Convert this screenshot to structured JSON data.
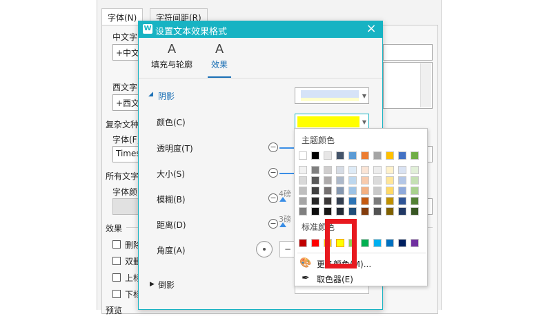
{
  "font_dialog": {
    "tabs": [
      "字体(N)",
      "字符间距(R)"
    ],
    "chinese_font_label": "中文字",
    "chinese_font_value": "+中文",
    "western_font_label": "西文字",
    "western_font_value": "+西文",
    "complex_script_label": "复杂文种",
    "complex_font_label": "字体(F)",
    "complex_font_value": "Times",
    "all_text_label": "所有文字",
    "font_color_label": "字体颜",
    "effects_label": "效果",
    "effects": [
      "删除",
      "双删",
      "上标",
      "下标"
    ],
    "preview_label": "预览"
  },
  "effects_dialog": {
    "title": "设置文本效果格式",
    "logo": "W",
    "close_icon": "×",
    "tabs": [
      {
        "label": "填充与轮廓",
        "icon": "A",
        "active": false
      },
      {
        "label": "效果",
        "icon": "A",
        "active": true
      }
    ],
    "shadow_section": "阴影",
    "rows": {
      "color": "颜色(C)",
      "transparency": "透明度(T)",
      "size": "大小(S)",
      "blur": "模糊(B)",
      "distance": "距离(D)",
      "angle": "角度(A)"
    },
    "blur_value": "4磅",
    "distance_value": "3磅",
    "reflection_section": "倒影",
    "shadow_preset_color": "#d6e3f8",
    "selected_color": "#ffff00"
  },
  "color_popup": {
    "theme_colors_label": "主题颜色",
    "theme_colors": [
      "#ffffff",
      "#000000",
      "#e7e6e6",
      "#44546a",
      "#5b9bd5",
      "#ed7d31",
      "#a5a5a5",
      "#ffc000",
      "#4472c4",
      "#70ad47"
    ],
    "shade_rows": [
      [
        "#f2f2f2",
        "#7f7f7f",
        "#d0cece",
        "#d6dce5",
        "#deebf7",
        "#fbe5d6",
        "#ededed",
        "#fff2cc",
        "#dae3f3",
        "#e2f0d9"
      ],
      [
        "#d9d9d9",
        "#595959",
        "#aeabab",
        "#adb9ca",
        "#bdd7ee",
        "#f8cbad",
        "#dbdbdb",
        "#ffe699",
        "#b4c7e7",
        "#c5e0b4"
      ],
      [
        "#bfbfbf",
        "#404040",
        "#757171",
        "#8497b0",
        "#9dc3e6",
        "#f4b183",
        "#c9c9c9",
        "#ffd966",
        "#8faadc",
        "#a9d18e"
      ],
      [
        "#a6a6a6",
        "#262626",
        "#3b3838",
        "#333f50",
        "#2e75b6",
        "#c55a11",
        "#7b7b7b",
        "#bf9000",
        "#2f5597",
        "#538135"
      ],
      [
        "#808080",
        "#0d0d0d",
        "#171616",
        "#222a35",
        "#1f4e79",
        "#843c0c",
        "#525252",
        "#7f6000",
        "#203864",
        "#375623"
      ]
    ],
    "standard_colors_label": "标准颜色",
    "standard_colors": [
      "#c00000",
      "#ff0000",
      "#ffc000",
      "#ffff00",
      "#92d050",
      "#00b050",
      "#00b0f0",
      "#0070c0",
      "#002060",
      "#7030a0"
    ],
    "more_colors": "更多颜色(M)...",
    "eyedropper": "取色器(E)"
  }
}
